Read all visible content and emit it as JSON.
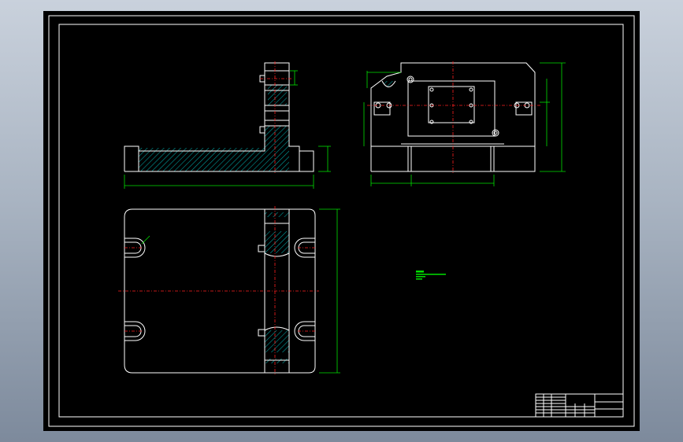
{
  "colors": {
    "viewport_bg": "#a9b4c2",
    "sheet": "#000000",
    "outline": "#ffffff",
    "dimension": "#00e000",
    "centerline": "#ff2020",
    "hatch": "#00b8b8"
  },
  "drawing": {
    "type": "cad-engineering-drawing",
    "views": [
      "front-section",
      "side-view",
      "top-view"
    ],
    "notes": {
      "heading": "",
      "lines": []
    },
    "title_block": {
      "visible": true
    }
  }
}
